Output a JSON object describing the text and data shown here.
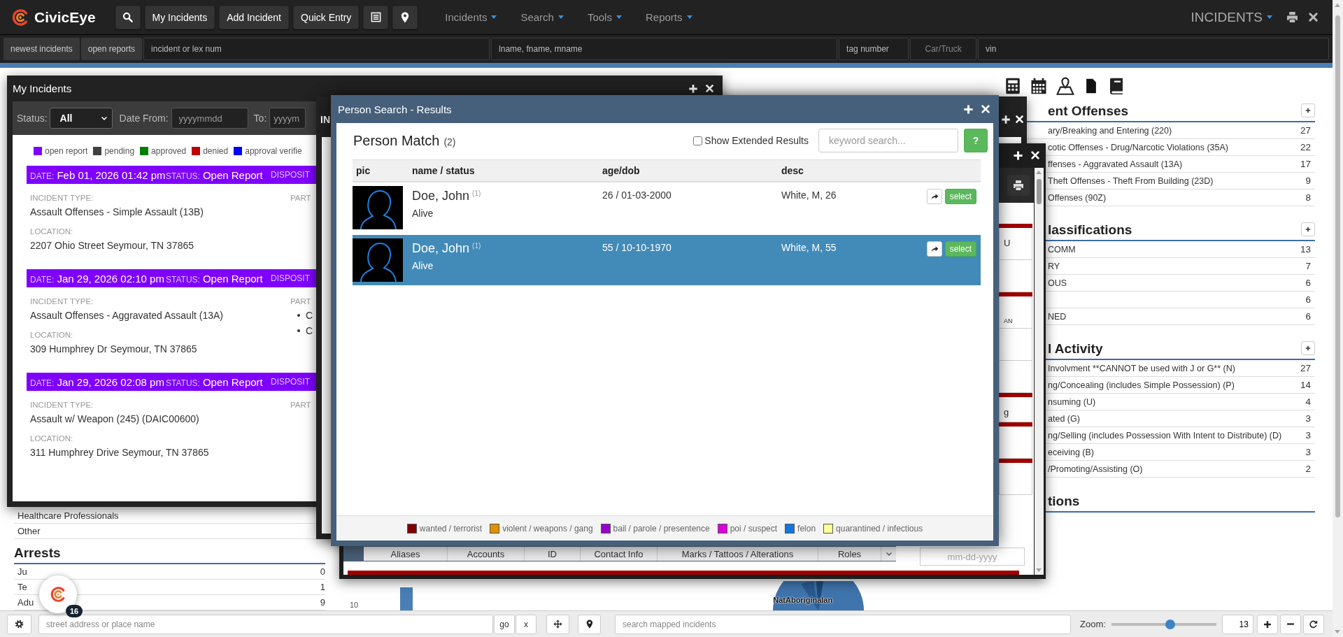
{
  "topbar": {
    "brand": "CivicEye",
    "buttons": [
      "My Incidents",
      "Add Incident",
      "Quick Entry"
    ],
    "menus": [
      "Incidents",
      "Search",
      "Tools",
      "Reports"
    ],
    "module": "INCIDENTS"
  },
  "quick_search": {
    "buttons": [
      "newest incidents",
      "open reports"
    ],
    "fields": [
      {
        "kind": "input",
        "placeholder": "incident or lex num"
      },
      {
        "kind": "input",
        "placeholder": "lname, fname, mname"
      },
      {
        "kind": "input",
        "placeholder": "tag number"
      },
      {
        "kind": "select",
        "placeholder": "Car/Truck"
      },
      {
        "kind": "input",
        "placeholder": "vin"
      }
    ]
  },
  "dashboard": {
    "left_rows": [
      {
        "label": "Healthcare Professionals"
      },
      {
        "label": "Other"
      }
    ],
    "arrests": {
      "title": "Arrests",
      "rows": [
        {
          "label": "Ju",
          "count": "0"
        },
        {
          "label": "Te",
          "count": "1"
        },
        {
          "label": "Adu",
          "count": "9"
        }
      ]
    },
    "chart_tick": "10",
    "pie_label": "NatAboriginalan",
    "right_sections": [
      {
        "title": "ent Offenses",
        "add_button": true,
        "rows": [
          {
            "label": "ary/Breaking and Entering (220)",
            "count": "27"
          },
          {
            "label": "cotic Offenses - Drug/Narcotic Violations (35A)",
            "count": "22"
          },
          {
            "label": "ffenses - Aggravated Assault (13A)",
            "count": "17"
          },
          {
            "label": "Theft Offenses - Theft From Building (23D)",
            "count": "9"
          },
          {
            "label": "Offenses (90Z)",
            "count": "8"
          }
        ]
      },
      {
        "title": "lassifications",
        "add_button": true,
        "rows": [
          {
            "label": "COMM",
            "count": "13"
          },
          {
            "label": "RY",
            "count": "7"
          },
          {
            "label": "OUS",
            "count": "6"
          },
          {
            "count": "6"
          },
          {
            "label": "NED",
            "count": "6"
          }
        ]
      },
      {
        "title": "l Activity",
        "add_button": true,
        "rows": [
          {
            "label": "Involvment **CANNOT be used with J or G** (N)",
            "count": "27"
          },
          {
            "label": "ng/Concealing (includes Simple Possession) (P)",
            "count": "14"
          },
          {
            "label": "nsuming (U)",
            "count": "4"
          },
          {
            "label": "ated (G)",
            "count": "3"
          },
          {
            "label": "ng/Selling (includes Possession With Intent to Distribute) (D)",
            "count": "3"
          },
          {
            "label": "eceiving (B)",
            "count": "3"
          },
          {
            "label": "/Promoting/Assisting (O)",
            "count": "2"
          }
        ]
      },
      {
        "title": "tions",
        "add_button": false
      }
    ]
  },
  "my_incidents": {
    "title": "My Incidents",
    "status_label": "Status:",
    "status_value": "All",
    "date_from_label": "Date From:",
    "date_from_placeholder": "yyyymmdd",
    "to_label": "To:",
    "to_placeholder": "yyyym",
    "legend": [
      {
        "label": "open report",
        "color": "#8000ff"
      },
      {
        "label": "pending",
        "color": "#404040"
      },
      {
        "label": "approved",
        "color": "#008000"
      },
      {
        "label": "denied",
        "color": "#c00000"
      },
      {
        "label": "approval verifie",
        "color": "#0000ff"
      }
    ],
    "incidents": [
      {
        "color": "#8000ff",
        "date_label": "DATE:",
        "date": "Feb 01, 2026 01:42 pm",
        "status_label": "STATUS:",
        "status": "Open Report",
        "disposition_label": "DISPOSIT",
        "type_label": "INCIDENT TYPE:",
        "type": "Assault Offenses - Simple Assault (13B)",
        "location_label": "LOCATION:",
        "location": "2207 Ohio Street Seymour, TN 37865",
        "party_label": "PART"
      },
      {
        "color": "#8000ff",
        "date_label": "DATE:",
        "date": "Jan 29, 2026 02:10 pm",
        "status_label": "STATUS:",
        "status": "Open Report",
        "disposition_label": "DISPOSIT",
        "type_label": "INCIDENT TYPE:",
        "type": "Assault Offenses - Aggravated Assault (13A)",
        "location_label": "LOCATION:",
        "location": "309 Humphrey Dr Seymour, TN 37865",
        "party_label": "PART",
        "parties": [
          "C",
          "C"
        ]
      },
      {
        "color": "#8000ff",
        "date_label": "DATE:",
        "date": "Jan 29, 2026 02:08 pm",
        "status_label": "STATUS:",
        "status": "Open Report",
        "disposition_label": "DISPOSIT",
        "type_label": "INCIDENT TYPE:",
        "type": "Assault w/ Weapon (245) (DAIC00600)",
        "location_label": "LOCATION:",
        "location": "311 Humphrey Drive Seymour, TN 37865",
        "party_label": "PART"
      }
    ]
  },
  "background_windows": {
    "incident_window_title": "IN",
    "profile_tabs": [
      "Aliases",
      "Accounts",
      "ID",
      "Contact Info",
      "Marks / Tattoos / Alterations",
      "Roles"
    ],
    "date_placeholder": "mm-dd-yyyy",
    "form_fragments": [
      "U",
      "AN",
      "g"
    ]
  },
  "person_search": {
    "title": "Person Search - Results",
    "heading": "Person Match",
    "count": "(2)",
    "extended": {
      "label": "Show Extended Results",
      "checked": false
    },
    "search_placeholder": "keyword search...",
    "help": "?",
    "columns": [
      "pic",
      "name / status",
      "age/dob",
      "desc"
    ],
    "rows": [
      {
        "name": "Doe, John",
        "record_count": "(1)",
        "status": "Alive",
        "age_dob": "26 / 01-03-2000",
        "desc": "White, M, 26",
        "action": "select",
        "selected": false
      },
      {
        "name": "Doe, John",
        "record_count": "(1)",
        "status": "Alive",
        "age_dob": "55 / 10-10-1970",
        "desc": "White, M, 55",
        "action": "select",
        "selected": true
      }
    ],
    "legend": [
      {
        "label": "wanted / terrorist",
        "color": "#800000"
      },
      {
        "label": "violent / weapons / gang",
        "color": "#e09000"
      },
      {
        "label": "bail / parole / presentence",
        "color": "#9900cc"
      },
      {
        "label": "poi / suspect",
        "color": "#dd00dd"
      },
      {
        "label": "felon",
        "color": "#1177dd"
      },
      {
        "label": "quarantined / infectious",
        "color": "#ffff99"
      }
    ]
  },
  "chat": {
    "badge": "16"
  },
  "bottom_bar": {
    "address_placeholder": "street address or place name",
    "go": "go",
    "clear": "x",
    "map_search_placeholder": "search mapped incidents",
    "zoom_label": "Zoom:",
    "zoom": {
      "level": 0.56
    },
    "zoom_value": "13"
  }
}
